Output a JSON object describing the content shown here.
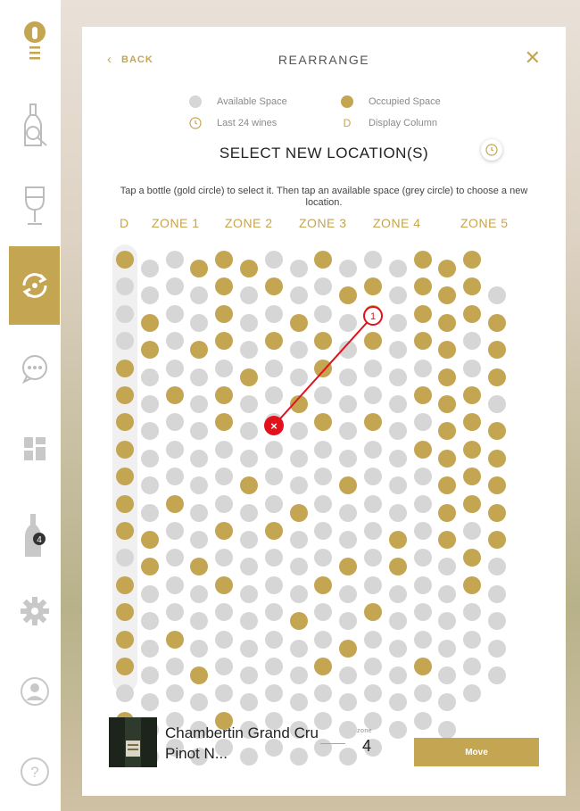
{
  "sidebar": {
    "items": [
      {
        "name": "menu-logo",
        "icon": "wine-menu-icon"
      },
      {
        "name": "cellar",
        "icon": "bottle-search-icon"
      },
      {
        "name": "tasting",
        "icon": "wine-glass-icon"
      },
      {
        "name": "rearrange",
        "icon": "rearrange-icon",
        "active": true
      },
      {
        "name": "chat",
        "icon": "chat-icon"
      },
      {
        "name": "dashboard",
        "icon": "grid-icon"
      },
      {
        "name": "bottles",
        "icon": "bottle-icon",
        "badge": "4"
      },
      {
        "name": "settings",
        "icon": "gear-icon"
      },
      {
        "name": "profile",
        "icon": "user-icon"
      },
      {
        "name": "help",
        "icon": "help-icon"
      }
    ]
  },
  "header": {
    "back_label": "BACK",
    "title": "REARRANGE"
  },
  "legend": {
    "available": "Available Space",
    "occupied": "Occupied Space",
    "recent": "Last 24 wines",
    "display_column": "Display Column",
    "display_column_letter": "D"
  },
  "subtitle": "SELECT NEW LOCATION(S)",
  "instructions": "Tap a bottle (gold circle) to select it. Then tap an available space (grey circle) to choose a new location.",
  "zones": [
    "D",
    "ZONE 1",
    "ZONE 2",
    "ZONE 3",
    "ZONE 4",
    "ZONE 5"
  ],
  "grid": {
    "rows": [
      "OGGOOOGGOGGGOOO",
      "GGGGOGOGGOOGOOOG",
      "GOGGOGGOGGOGOOOO",
      "GOGOOGOGOGOGOOGO",
      "OGGGGOGGOGGGGOGO",
      "OGOGOGGOGGGGOOOG",
      "OGGGOGGGOGOGGOOO",
      "OGGGGGGGGGGGOOOO",
      "OGGGGOGGGOGGGOOO",
      "OGOGGGGOGGGGGOOO",
      "OOGGOGOGGGGOGOGO",
      "GOGOGGGGGOGOGGOG",
      "OGGGOGGGOGGGGGOG",
      "OGGGGGGOGGOGGGGG",
      "OGOGGGGGGOGGGGGG",
      "OGGOGGGGOGGGOGGG",
      "GGGGGGGGGGGGGGG",
      "OGGGOGGGGGGGGG",
      "GGGGGGGGGGG"
    ]
  },
  "selection": {
    "from_marker": "1",
    "to_marker": "×"
  },
  "wine": {
    "name": "Chambertin Grand Cru Pinot N...",
    "zone_label": "zone",
    "zone_value": "4"
  },
  "move_label": "Move",
  "colors": {
    "accent": "#c4a552",
    "available": "#d6d6d6",
    "marker_red": "#e1121b"
  }
}
